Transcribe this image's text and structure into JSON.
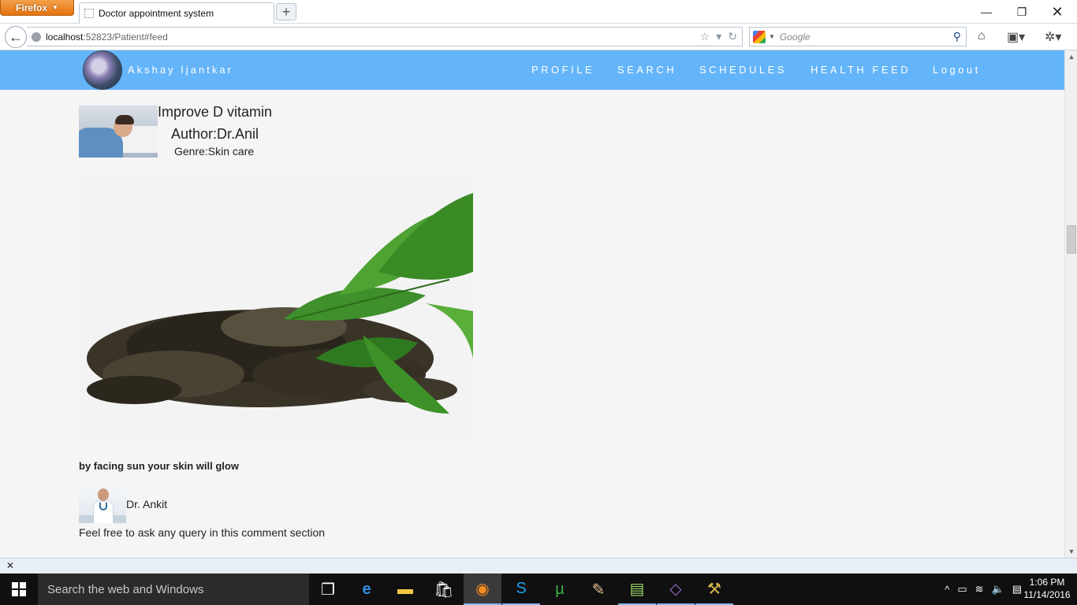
{
  "browser": {
    "menu_button": "Firefox",
    "tab_title": "Doctor appointment system",
    "new_tab": "+",
    "url_host": "localhost",
    "url_path": ":52823/Patient#feed",
    "search_placeholder": "Google"
  },
  "site": {
    "user_name": "Akshay Ijantkar",
    "nav": {
      "profile": "PROFILE",
      "search": "SEARCH",
      "schedules": "SCHEDULES",
      "health_feed": "HEALTH FEED",
      "logout": "Logout"
    }
  },
  "post": {
    "title": "Improve D vitamin",
    "author": "Author:Dr.Anil",
    "genre": "Genre:Skin care",
    "caption": "by facing sun your skin will glow"
  },
  "comment": {
    "doctor_name": "Dr. Ankit",
    "note": "Feel free to ask any query in this comment section"
  },
  "taskbar": {
    "search_placeholder": "Search the web and Windows",
    "time": "1:06 PM",
    "date": "11/14/2016"
  }
}
